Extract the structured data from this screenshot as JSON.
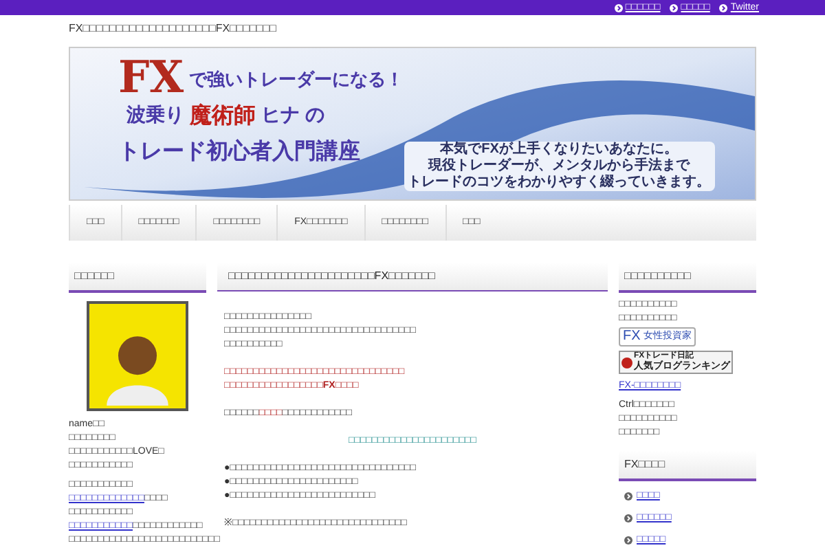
{
  "top_links": [
    "□□□□□□",
    "□□□□□",
    "Twitter"
  ],
  "site_description": "FX□□□□□□□□□□□□□□□□□□□□FX□□□□□□□",
  "banner": {
    "logo": "FX",
    "tagline": "で強いトレーダーになる！",
    "name_line": [
      {
        "text": "波乗り",
        "red": false
      },
      {
        "text": "魔術師",
        "red": true
      },
      {
        "text": "ヒナ",
        "red": false
      },
      {
        "text": "の",
        "red": false
      }
    ],
    "course": "トレード初心者入門講座",
    "message": [
      "本気でFXが上手くなりたいあなたに。",
      "現役トレーダーが、メンタルから手法まで",
      "トレードのコツをわかりやすく綴っていきます。"
    ]
  },
  "nav": [
    {
      "label": "□□□",
      "selected": false
    },
    {
      "label": "□□□□□□□",
      "selected": false
    },
    {
      "label": "□□□□□□□□",
      "selected": false
    },
    {
      "label": "FX□□□□□□□",
      "selected": false
    },
    {
      "label": "□□□□□□□□",
      "selected": false
    },
    {
      "label": "□□□",
      "selected": false
    }
  ],
  "left_sidebar": {
    "heading": "□□□□□□",
    "profile": [
      "name□□",
      "□□□□□□□□",
      "□□□□□□□□□□□LOVE□",
      "□□□□□□□□□□□"
    ],
    "lines": [
      {
        "text": "□□□□□□□□□□□"
      },
      {
        "link": "□□□□□□□□□□□□□",
        "text": "□□□□"
      },
      {
        "text": "□□□□□□□□□□□"
      },
      {
        "link": "□□□□□□□□□□□",
        "text": "□□□□□□□□□□□□"
      },
      {
        "text": "□□□□□□□□□□□□□□□□□□□□□□□□□□"
      }
    ]
  },
  "article": {
    "title": "□□□□□□□□□□□□□□□□□□□□□□FX□□□□□□□",
    "blocks": [
      {
        "kind": "plain",
        "lines": [
          [
            {
              "text": "□□□□□□□□□□□□□□□",
              "red": false
            }
          ],
          [
            {
              "text": "□□□□□□□□□□□□□□□□□□□□□□□□□□□□□□□□□",
              "red": false
            }
          ],
          [
            {
              "text": "□□□□□□□□□□",
              "red": false
            }
          ]
        ]
      },
      {
        "kind": "plain",
        "lines": [
          [
            {
              "text": "□□□□□□□□□□□□□□□□□□□□□□□□□□□□□□□",
              "red": true
            }
          ],
          [
            {
              "text": "□□□□□□□□□□□□□□□□□**FX**□□□□",
              "red": true
            }
          ]
        ]
      },
      {
        "kind": "plain",
        "lines": [
          [
            {
              "text": "□□□□□□",
              "red": false
            },
            {
              "text": "□□□□",
              "red": true
            },
            {
              "text": "□□□□□□□□□□□□",
              "red": false
            }
          ]
        ]
      },
      {
        "kind": "teal",
        "lines": [
          [
            {
              "text": "□□□□□□□□□□□□□□□□□□□□□□",
              "red": false
            }
          ]
        ]
      },
      {
        "kind": "plain",
        "lines": [
          [
            {
              "text": "●□□□□□□□□□□□□□□□□□□□□□□□□□□□□□□□□",
              "red": false
            }
          ],
          [
            {
              "text": "●□□□□□□□□□□□□□□□□□□□□□□",
              "red": false
            }
          ],
          [
            {
              "text": "●□□□□□□□□□□□□□□□□□□□□□□□□□",
              "red": false
            }
          ]
        ]
      },
      {
        "kind": "plain",
        "lines": [
          [
            {
              "text": "※□□□□□□□□□□□□□□□□□□□□□□□□□□□□□□",
              "red": false
            }
          ]
        ]
      }
    ]
  },
  "right_sidebar": {
    "heading": "□□□□□□□□□□",
    "intro": [
      "□□□□□□□□□□",
      "□□□□□□□□□□"
    ],
    "badge_investor": {
      "prefix": "FX",
      "label": "女性投資家"
    },
    "badge_ranking": {
      "title": "FXトレード日記",
      "subtitle": "人気ブログランキング"
    },
    "link": "FX-□□□□□□□□",
    "notes": [
      "Ctrl□□□□□□□",
      "□□□□□□□□□□",
      "□□□□□□□"
    ],
    "section2": {
      "heading": "FX□□□□",
      "links": [
        "□□□□",
        "□□□□□□",
        "□□□□□"
      ]
    }
  }
}
